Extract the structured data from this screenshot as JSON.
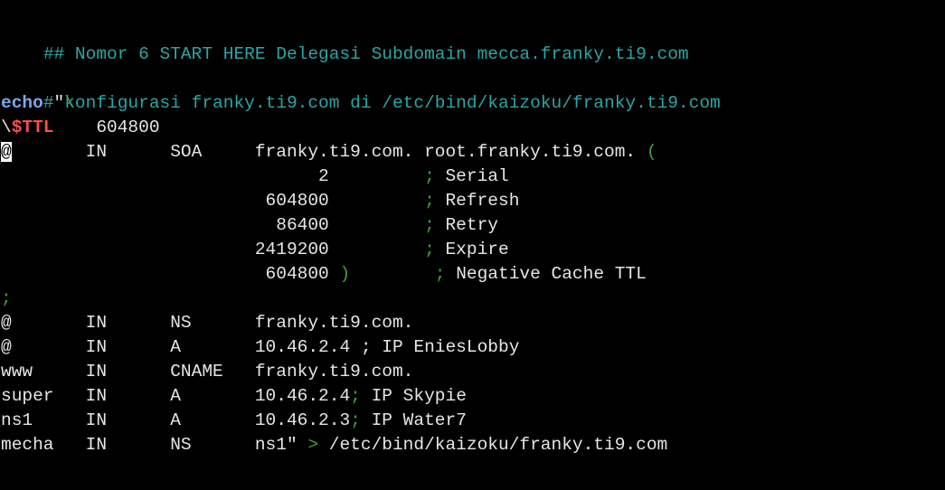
{
  "terminal": {
    "colors": {
      "background": "#000000",
      "text": "#e6e6e6",
      "comment": "#2aa6a6",
      "keyword": "#7ba7e8",
      "ttl": "#ff4d4d",
      "delimiter": "#3fa03f"
    },
    "line1": {
      "text": "## Nomor 6 START HERE Delegasi Subdomain mecca.franky.ti9.com"
    },
    "line2": {
      "text": "# konfigurasi franky.ti9.com di /etc/bind/kaizoku/franky.ti9.com"
    },
    "line3": {
      "cmd": "echo",
      "rest": " \"",
      "bs": "\\"
    },
    "line4": {
      "bs": "\\",
      "ttl": "$TTL",
      "value": "    604800"
    },
    "line5": {
      "cursor": "@",
      "text": "       IN      SOA     franky.ti9.com. root.franky.ti9.com. ",
      "paren": "("
    },
    "line6": {
      "pre": "                              2         ",
      "semi": ";",
      "rest": " Serial"
    },
    "line7": {
      "pre": "                         604800         ",
      "semi": ";",
      "rest": " Refresh"
    },
    "line8": {
      "pre": "                          86400         ",
      "semi": ";",
      "rest": " Retry"
    },
    "line9": {
      "pre": "                        2419200         ",
      "semi": ";",
      "rest": " Expire"
    },
    "line10": {
      "pre": "                         604800 ",
      "paren": ")",
      "mid": "        ",
      "semi": ";",
      "rest": " Negative Cache TTL"
    },
    "line11": {
      "semi": ";"
    },
    "line12": {
      "text": "@       IN      NS      franky.ti9.com."
    },
    "line13": {
      "text": "@       IN      A       10.46.2.4 ; IP EniesLobby"
    },
    "line14": {
      "text": "www     IN      CNAME   franky.ti9.com."
    },
    "line15": {
      "pre": "super   IN      A       10.46.2.4",
      "semi": ";",
      "rest": " IP Skypie"
    },
    "line16": {
      "pre": "ns1     IN      A       10.46.2.3",
      "semi": ";",
      "rest": " IP Water7"
    },
    "line17": {
      "pre": "mecha   IN      NS      ns1\" ",
      "gt": ">",
      "rest": " /etc/bind/kaizoku/franky.ti9.com"
    }
  }
}
